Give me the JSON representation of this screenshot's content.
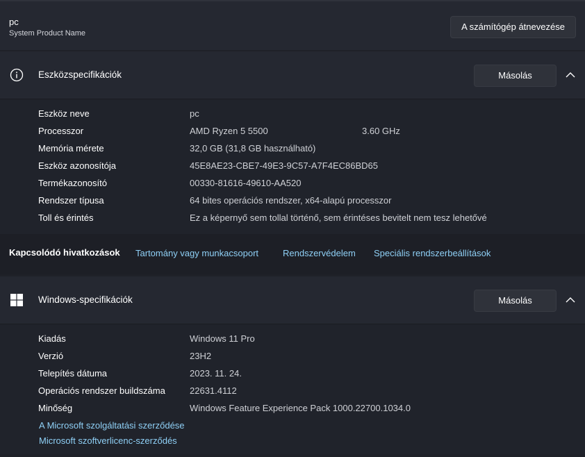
{
  "device": {
    "name": "pc",
    "model": "System Product Name",
    "rename_button": "A számítógép átnevezése"
  },
  "device_specs": {
    "title": "Eszközspecifikációk",
    "copy_button": "Másolás",
    "rows": [
      {
        "label": "Eszköz neve",
        "value": "pc"
      },
      {
        "label": "Processzor",
        "value": "AMD Ryzen 5 5500",
        "extra": "3.60 GHz"
      },
      {
        "label": "Memória mérete",
        "value": "32,0 GB (31,8 GB használható)"
      },
      {
        "label": "Eszköz azonosítója",
        "value": "45E8AE23-CBE7-49E3-9C57-A7F4EC86BD65"
      },
      {
        "label": "Termékazonosító",
        "value": "00330-81616-49610-AA520"
      },
      {
        "label": "Rendszer típusa",
        "value": "64 bites operációs rendszer, x64-alapú processzor"
      },
      {
        "label": "Toll és érintés",
        "value": "Ez a képernyő sem tollal történő, sem érintéses bevitelt nem tesz lehetővé"
      }
    ]
  },
  "related_links": {
    "title": "Kapcsolódó hivatkozások",
    "links": [
      "Tartomány vagy munkacsoport",
      "Rendszervédelem",
      "Speciális rendszerbeállítások"
    ]
  },
  "windows_specs": {
    "title": "Windows-specifikációk",
    "copy_button": "Másolás",
    "rows": [
      {
        "label": "Kiadás",
        "value": "Windows 11 Pro"
      },
      {
        "label": "Verzió",
        "value": "23H2"
      },
      {
        "label": "Telepítés dátuma",
        "value": "2023. 11. 24."
      },
      {
        "label": "Operációs rendszer buildszáma",
        "value": "22631.4112"
      },
      {
        "label": "Minőség",
        "value": "Windows Feature Experience Pack 1000.22700.1034.0"
      }
    ],
    "links": [
      "A Microsoft szolgáltatási szerződése",
      "Microsoft szoftverlicenc-szerződés"
    ]
  },
  "icons": {
    "device_specs": "info-icon",
    "windows_specs": "windows-logo-icon",
    "collapse": "chevron-up-icon"
  },
  "colors": {
    "link": "#8fd0f6",
    "background": "#1f2128",
    "card": "#252831"
  }
}
